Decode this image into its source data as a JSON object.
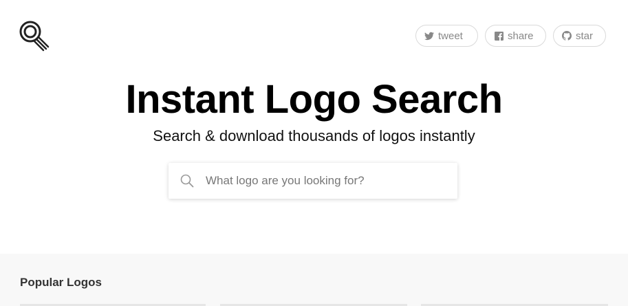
{
  "header": {
    "logo_icon": "magnifier-logo-icon",
    "social": [
      {
        "icon": "twitter-icon",
        "label": "tweet"
      },
      {
        "icon": "facebook-icon",
        "label": "share"
      },
      {
        "icon": "github-icon",
        "label": "star"
      }
    ]
  },
  "hero": {
    "title": "Instant Logo Search",
    "subtitle": "Search & download thousands of logos instantly"
  },
  "search": {
    "icon": "search-icon",
    "placeholder": "What logo are you looking for?",
    "value": ""
  },
  "popular": {
    "heading": "Popular Logos"
  },
  "colors": {
    "background": "#ffffff",
    "section_bg": "#f8f8f8",
    "pill_border": "#d9d9d9",
    "pill_text": "#888888",
    "title": "#000000"
  }
}
